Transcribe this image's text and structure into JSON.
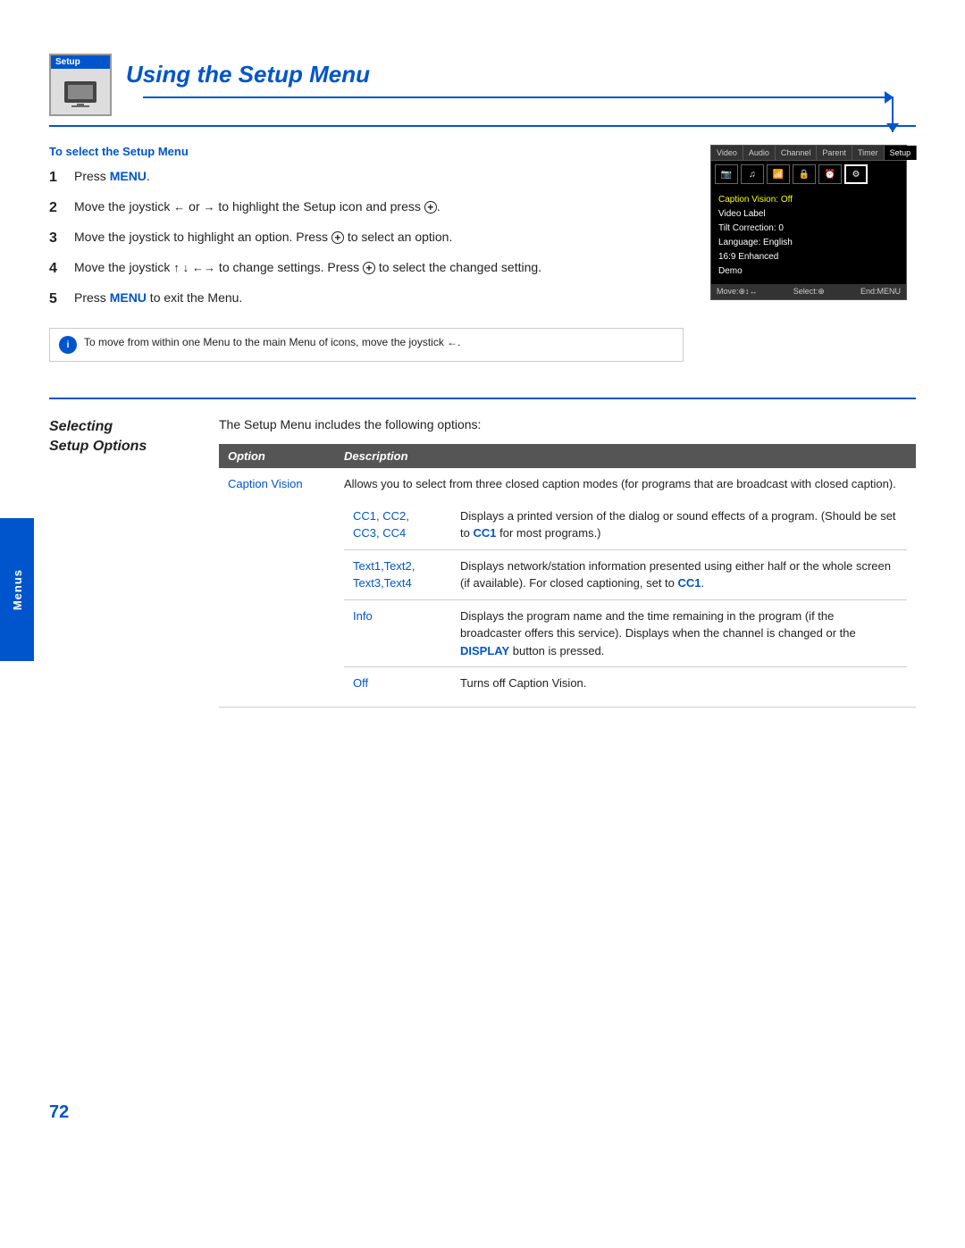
{
  "page": {
    "number": "72",
    "left_tab_label": "Menus"
  },
  "header": {
    "badge": "Setup",
    "title": "Using the Setup Menu",
    "subtitle": "To select the Setup Menu"
  },
  "steps": [
    {
      "num": "1",
      "text": "Press ",
      "highlight": "MENU",
      "rest": "."
    },
    {
      "num": "2",
      "text": "Move the joystick ← or → to highlight the Setup icon and press ⊕."
    },
    {
      "num": "3",
      "text": "Move the joystick to highlight an option. Press ⊕ to select an option."
    },
    {
      "num": "4",
      "text": "Move the joystick ↑ ↓ ← → to change settings. Press ⊕ to select the changed setting."
    },
    {
      "num": "5",
      "text": "Press ",
      "highlight": "MENU",
      "rest": " to exit the Menu."
    }
  ],
  "note": {
    "text": "To move from within one Menu to the main Menu of icons, move the joystick ←."
  },
  "menu_screenshot": {
    "tabs": [
      "Video",
      "Audio",
      "Channel",
      "Parent",
      "Timer",
      "Setup"
    ],
    "active_tab": "Setup",
    "menu_items": [
      "Caption Vision: Off",
      "Video Label",
      "Tilt Correction: 0",
      "Language: English",
      "16:9 Enhanced",
      "Demo"
    ],
    "highlighted_item": "Caption Vision: Off",
    "footer": "Move:⊕↑↓←→   Select:⊕   End:MENU"
  },
  "selecting_section": {
    "heading_line1": "Selecting",
    "heading_line2": "Setup Options",
    "intro": "The Setup Menu includes the following options:",
    "table_headers": [
      "Option",
      "Description"
    ],
    "options": [
      {
        "name": "Caption Vision",
        "description": "Allows you to select from three closed caption modes (for programs that are broadcast with closed caption).",
        "sub_options": [
          {
            "name": "CC1, CC2, CC3, CC4",
            "description": "Displays a printed version of the dialog or sound effects of a program. (Should be set to CC1 for most programs.)"
          },
          {
            "name": "Text1,Text2, Text3,Text4",
            "description": "Displays network/station information presented using either half or the whole screen (if available). For closed captioning, set to CC1."
          },
          {
            "name": "Info",
            "description": "Displays the program name and the time remaining in the program (if the broadcaster offers this service). Displays when the channel is changed or the DISPLAY button is pressed."
          },
          {
            "name": "Off",
            "description": "Turns off Caption Vision."
          }
        ]
      }
    ]
  }
}
